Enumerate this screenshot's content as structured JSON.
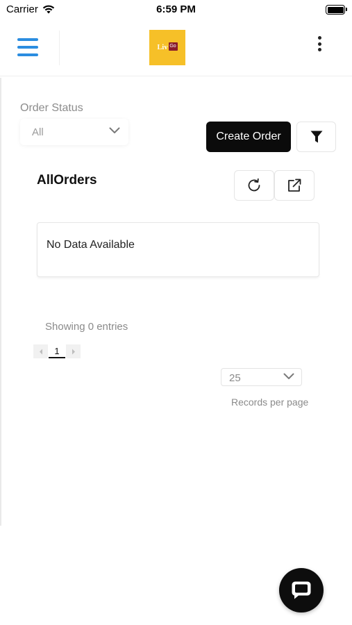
{
  "status_bar": {
    "carrier": "Carrier",
    "time": "6:59 PM"
  },
  "header": {
    "menu_icon": "hamburger-menu-icon",
    "logo_text": "Liv",
    "logo_bag_text": "Go",
    "more_icon": "kebab-more-icon",
    "accent_color": "#2b8de0",
    "logo_color": "#f6c028"
  },
  "filters": {
    "order_status_label": "Order Status",
    "order_status_value": "All"
  },
  "toolbar": {
    "create_order_label": "Create Order",
    "filter_icon": "filter-funnel-icon"
  },
  "orders": {
    "title": "AllOrders",
    "refresh_icon": "refresh-icon",
    "export_icon": "export-external-link-icon",
    "empty_message": "No Data Available",
    "showing_text": "Showing 0 entries"
  },
  "pagination": {
    "current_page": "1",
    "records_per_page_value": "25",
    "records_per_page_label": "Records per page"
  },
  "chat": {
    "icon": "chat-bubble-icon"
  }
}
